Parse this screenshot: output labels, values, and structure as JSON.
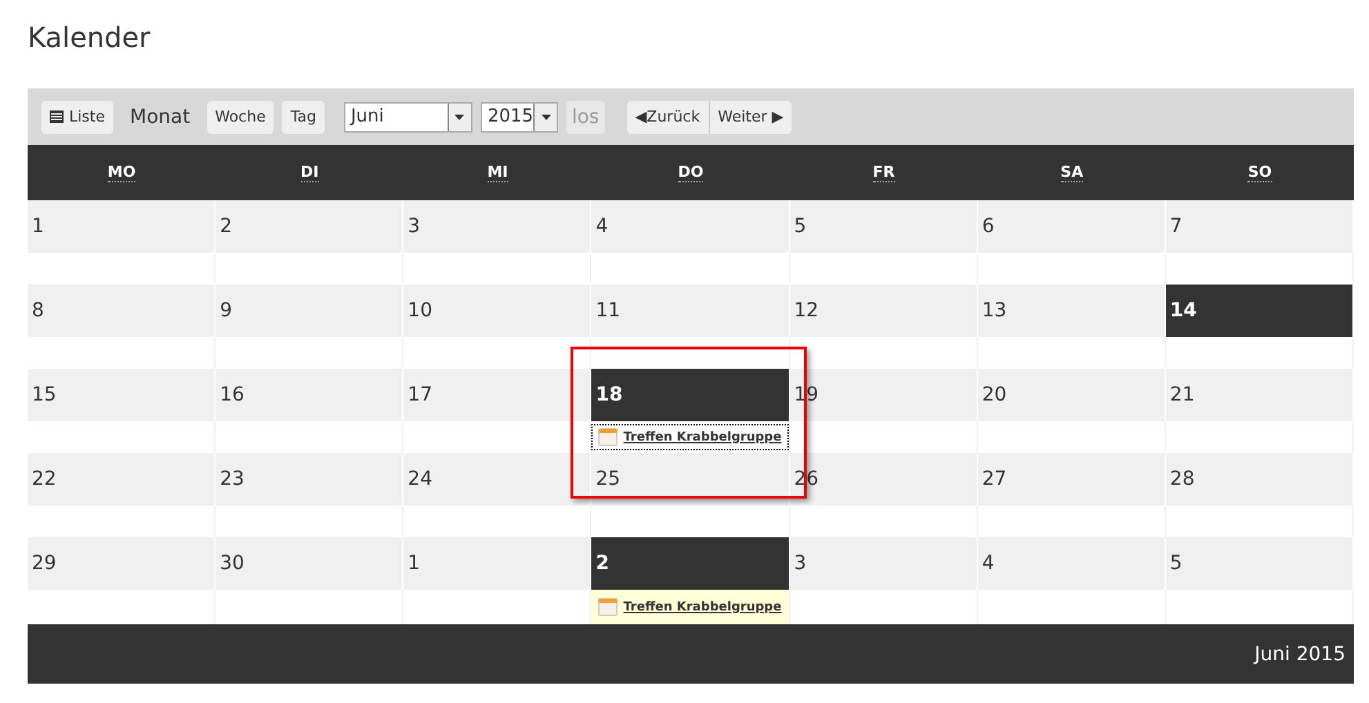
{
  "title": "Kalender",
  "toolbar": {
    "list_button": "Liste",
    "views": [
      {
        "label": "Monat",
        "selected": true
      },
      {
        "label": "Woche",
        "selected": false
      },
      {
        "label": "Tag",
        "selected": false
      }
    ],
    "month_select": "Juni",
    "year_select": "2015",
    "go_button": "los",
    "prev_button": "◀Zurück",
    "next_button": "Weiter ▶"
  },
  "weekdays": [
    "MO",
    "DI",
    "MI",
    "DO",
    "FR",
    "SA",
    "SO"
  ],
  "weeks": [
    {
      "days": [
        {
          "day": "1",
          "highlighted": false
        },
        {
          "day": "2",
          "highlighted": false
        },
        {
          "day": "3",
          "highlighted": false
        },
        {
          "day": "4",
          "highlighted": false
        },
        {
          "day": "5",
          "highlighted": false
        },
        {
          "day": "6",
          "highlighted": false
        },
        {
          "day": "7",
          "highlighted": false
        }
      ]
    },
    {
      "days": [
        {
          "day": "8",
          "highlighted": false
        },
        {
          "day": "9",
          "highlighted": false
        },
        {
          "day": "10",
          "highlighted": false
        },
        {
          "day": "11",
          "highlighted": false
        },
        {
          "day": "12",
          "highlighted": false
        },
        {
          "day": "13",
          "highlighted": false
        },
        {
          "day": "14",
          "highlighted": true
        }
      ]
    },
    {
      "days": [
        {
          "day": "15",
          "highlighted": false
        },
        {
          "day": "16",
          "highlighted": false
        },
        {
          "day": "17",
          "highlighted": false
        },
        {
          "day": "18",
          "highlighted": true,
          "events": [
            {
              "title": "Treffen Krabbelgruppe",
              "focused": true
            }
          ]
        },
        {
          "day": "19",
          "highlighted": false
        },
        {
          "day": "20",
          "highlighted": false
        },
        {
          "day": "21",
          "highlighted": false
        }
      ]
    },
    {
      "days": [
        {
          "day": "22",
          "highlighted": false
        },
        {
          "day": "23",
          "highlighted": false
        },
        {
          "day": "24",
          "highlighted": false
        },
        {
          "day": "25",
          "highlighted": false
        },
        {
          "day": "26",
          "highlighted": false
        },
        {
          "day": "27",
          "highlighted": false
        },
        {
          "day": "28",
          "highlighted": false
        }
      ]
    },
    {
      "days": [
        {
          "day": "29",
          "highlighted": false
        },
        {
          "day": "30",
          "highlighted": false
        },
        {
          "day": "1",
          "highlighted": false
        },
        {
          "day": "2",
          "highlighted": true,
          "events": [
            {
              "title": "Treffen Krabbelgruppe",
              "focused": false
            }
          ]
        },
        {
          "day": "3",
          "highlighted": false
        },
        {
          "day": "4",
          "highlighted": false
        },
        {
          "day": "5",
          "highlighted": false
        }
      ]
    }
  ],
  "footer": "Juni 2015"
}
